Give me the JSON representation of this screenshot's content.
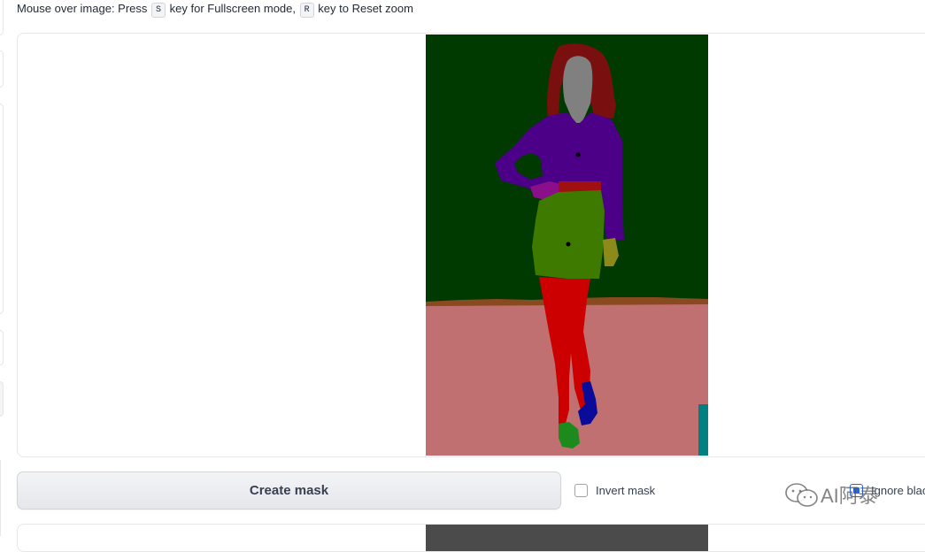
{
  "hint": {
    "prefix": "Mouse over image: Press",
    "key_s": "S",
    "middle": "key for Fullscreen mode,",
    "key_r": "R",
    "suffix": "key to Reset zoom"
  },
  "segmentation_image": {
    "colors": {
      "background": "#003a00",
      "floor": "#c07070",
      "hair": "#7a0f0f",
      "face": "#808080",
      "shirt": "#4b0087",
      "skirt": "#3e7a00",
      "legs": "#cc0000",
      "belt": "#a01010",
      "hand": "#8b0f8b",
      "right_hand": "#8c8a1a",
      "shoe_left": "#1d8a1d",
      "shoe_right": "#0b0b9a",
      "teal_object": "#008080"
    }
  },
  "controls": {
    "create_mask_label": "Create mask",
    "invert_mask_label": "Invert mask",
    "invert_mask_checked": false,
    "ignore_black_label": "Ignore blac",
    "ignore_black_checked": true
  },
  "watermark": {
    "text": "AI阿泰"
  }
}
